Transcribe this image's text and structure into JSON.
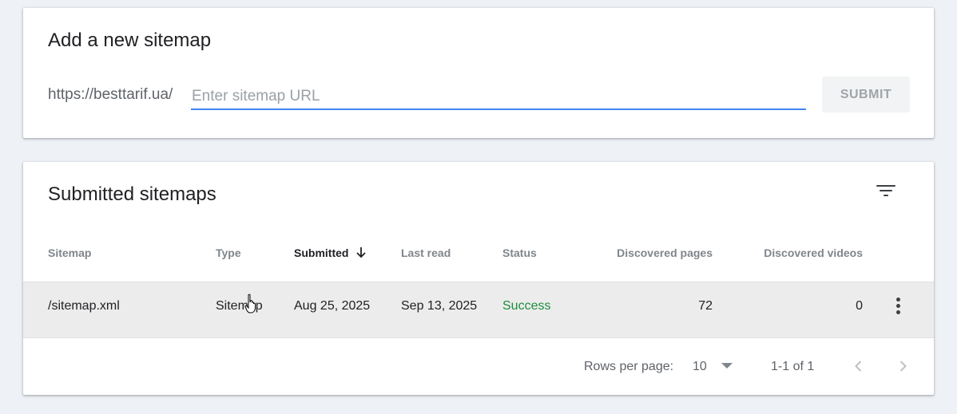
{
  "add_sitemap": {
    "title": "Add a new sitemap",
    "url_prefix": "https://besttarif.ua/",
    "input_placeholder": "Enter sitemap URL",
    "input_value": "",
    "submit_label": "SUBMIT"
  },
  "submitted": {
    "title": "Submitted sitemaps",
    "columns": {
      "sitemap": "Sitemap",
      "type": "Type",
      "submitted": "Submitted",
      "last_read": "Last read",
      "status": "Status",
      "discovered_pages": "Discovered pages",
      "discovered_videos": "Discovered videos"
    },
    "sorted_column": "submitted",
    "sort_direction": "descending",
    "rows": [
      {
        "sitemap": "/sitemap.xml",
        "type": "Sitemap",
        "submitted": "Aug 25, 2025",
        "last_read": "Sep 13, 2025",
        "status": "Success",
        "discovered_pages": "72",
        "discovered_videos": "0"
      }
    ],
    "footer": {
      "rows_per_page_label": "Rows per page:",
      "rows_per_page_value": "10",
      "range_text": "1-1 of 1"
    }
  },
  "icons": {
    "filter": "filter-icon",
    "sort": "arrow-down-icon",
    "more": "more-vert-icon",
    "prev": "chevron-left-icon",
    "next": "chevron-right-icon",
    "dropdown": "caret-down-icon"
  },
  "colors": {
    "accent": "#4285f4",
    "success": "#1e8e3e",
    "background": "#eef1f6"
  }
}
